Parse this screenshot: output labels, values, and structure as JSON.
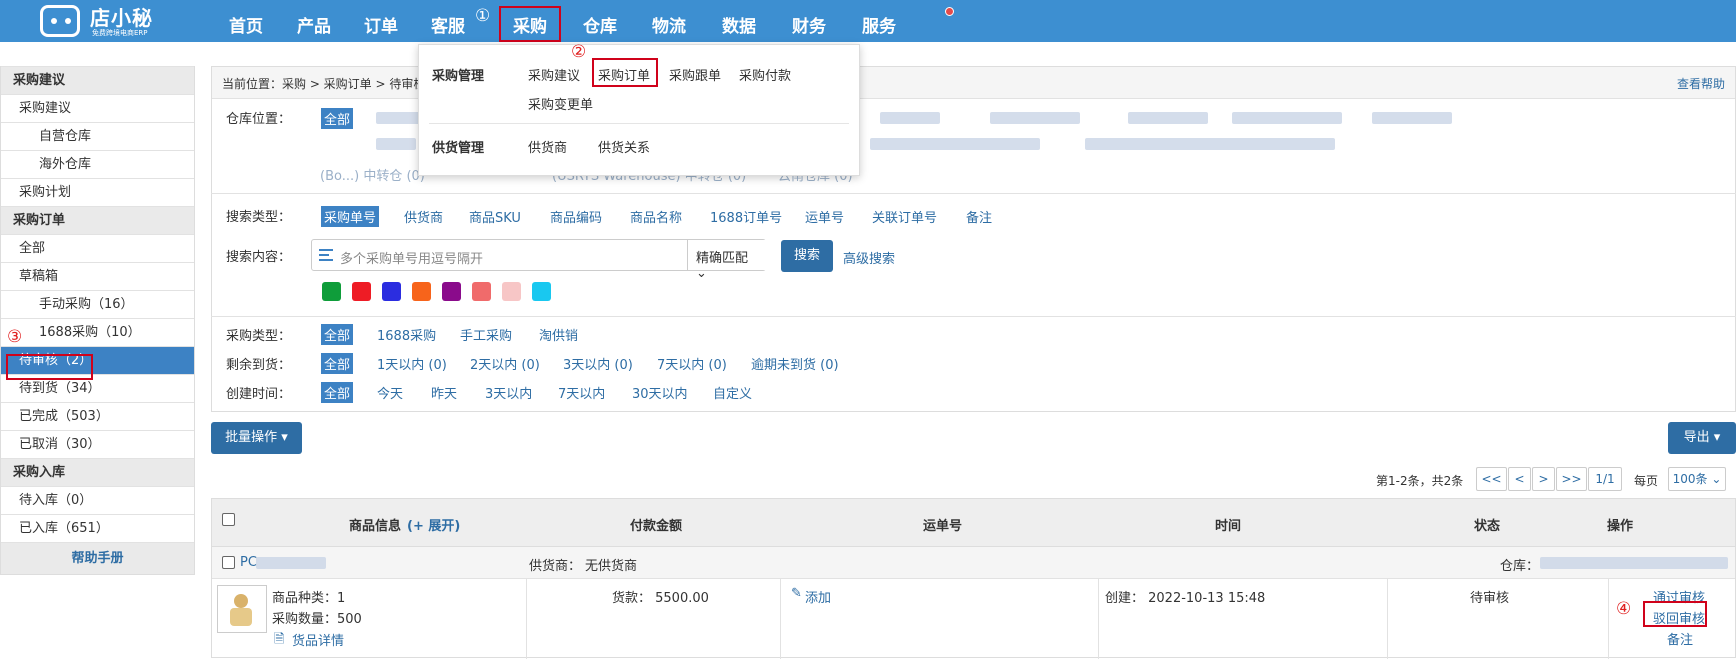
{
  "app": {
    "brand": "店小秘",
    "tagline": "免费跨境电商ERP"
  },
  "nav": [
    "首页",
    "产品",
    "订单",
    "客服",
    "采购",
    "仓库",
    "物流",
    "数据",
    "财务",
    "服务"
  ],
  "markers": [
    "①",
    "②",
    "③",
    "④"
  ],
  "dropdown": {
    "g1_title": "采购管理",
    "g1_items": [
      "采购建议",
      "采购订单",
      "采购跟单",
      "采购付款",
      "采购变更单"
    ],
    "g2_title": "供货管理",
    "g2_items": [
      "供货商",
      "供货关系"
    ]
  },
  "sidebar": {
    "h1": "采购建议",
    "i1": "采购建议",
    "i2": "自营仓库",
    "i3": "海外仓库",
    "i4": "采购计划",
    "h2": "采购订单",
    "i5": "全部",
    "i6": "草稿箱",
    "i7": "手动采购（16）",
    "i8": "1688采购（10）",
    "i9": "待审核（2）",
    "i10": "待到货（34）",
    "i11": "已完成（503）",
    "i12": "已取消（30）",
    "h3": "采购入库",
    "i13": "待入库（0）",
    "i14": "已入库（651）",
    "help": "帮助手册"
  },
  "breadcrumb": "当前位置：采购 > 采购订单 > 待审核",
  "help_link": "查看帮助",
  "filters": {
    "warehouse_label": "仓库位置：",
    "all": "全部",
    "wh_visible": [
      "(Bo...) 中转仓 (0)",
      "(USRTS Warehouse) 中转仓 (0)",
      "云南仓库 (0)"
    ],
    "stype_label": "搜索类型：",
    "stypes": [
      "采购单号",
      "供货商",
      "商品SKU",
      "商品编码",
      "商品名称",
      "1688订单号",
      "运单号",
      "关联订单号",
      "备注"
    ],
    "scontent_label": "搜索内容：",
    "placeholder": "多个采购单号用逗号隔开",
    "match": "精确匹配",
    "search_btn": "搜索",
    "adv": "高级搜索",
    "ptype_label": "采购类型：",
    "ptypes": [
      "全部",
      "1688采购",
      "手工采购",
      "淘供销"
    ],
    "arrive_label": "剩余到货：",
    "arrive": [
      "全部",
      "1天以内 (0)",
      "2天以内 (0)",
      "3天以内 (0)",
      "7天以内 (0)",
      "逾期未到货 (0)"
    ],
    "ctime_label": "创建时间：",
    "ctime": [
      "全部",
      "今天",
      "昨天",
      "3天以内",
      "7天以内",
      "30天以内",
      "自定义"
    ]
  },
  "colors": [
    "#0f9d3a",
    "#ee1c25",
    "#2b2de0",
    "#f7641b",
    "#8a0b8b",
    "#f06b6b",
    "#f7c6c6",
    "#19c8f0"
  ],
  "batch_btn": "批量操作 ▾",
  "export_btn": "导出 ▾",
  "pager": {
    "info": "第1-2条，共2条",
    "first": "<<",
    "prev": "<",
    "next": ">",
    "last": ">>",
    "page": "1/1",
    "per_label": "每页",
    "per": "100条"
  },
  "table": {
    "headers": [
      "商品信息",
      "(+ 展开)",
      "付款金额",
      "运单号",
      "时间",
      "状态",
      "操作"
    ],
    "group": {
      "order_no": "PC",
      "supplier_label": "供货商：",
      "supplier": "无供货商",
      "wh_label": "仓库："
    },
    "row": {
      "kinds": "商品种类：1",
      "qty": "采购数量：500",
      "detail": "货品详情",
      "amount": "货款：  5500.00",
      "add": "添加",
      "created": "创建：  2022-10-13 15:48",
      "status": "待审核",
      "act1": "通过审核",
      "act2": "驳回审核",
      "act3": "备注"
    }
  }
}
